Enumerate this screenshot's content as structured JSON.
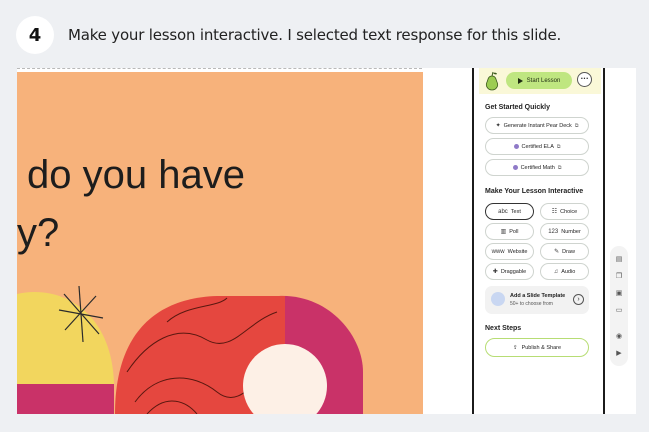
{
  "step": {
    "number": "4",
    "instruction": "Make your lesson interactive. I selected text response for this slide."
  },
  "slide": {
    "line1": "do you have",
    "line2": "y?"
  },
  "panel": {
    "start_label": "Start Lesson",
    "more_label": "···",
    "get_started_title": "Get Started Quickly",
    "get_started": [
      {
        "label": "Generate Instant Pear Deck",
        "icon": "sparkle-icon",
        "glyph": "✦",
        "external": "⧉"
      },
      {
        "label": "Certified ELA",
        "icon": "badge-icon",
        "glyph": "",
        "external": "⧉"
      },
      {
        "label": "Certified Math",
        "icon": "badge-icon",
        "glyph": "",
        "external": "⧉"
      }
    ],
    "interactive_title": "Make Your Lesson Interactive",
    "interactive": [
      {
        "label": "Text",
        "glyph": "abc",
        "icon": "text-response-icon",
        "selected": true
      },
      {
        "label": "Choice",
        "glyph": "☷",
        "icon": "choice-icon",
        "selected": false
      },
      {
        "label": "Poll",
        "glyph": "▥",
        "icon": "poll-icon",
        "selected": false
      },
      {
        "label": "Number",
        "glyph": "123",
        "icon": "number-icon",
        "selected": false
      },
      {
        "label": "Website",
        "glyph": "www",
        "icon": "website-icon",
        "selected": false
      },
      {
        "label": "Draw",
        "glyph": "✎",
        "icon": "draw-icon",
        "selected": false
      },
      {
        "label": "Draggable",
        "glyph": "✚",
        "icon": "draggable-icon",
        "selected": false
      },
      {
        "label": "Audio",
        "glyph": "♫",
        "icon": "audio-icon",
        "selected": false
      }
    ],
    "template_title": "Add a Slide Template",
    "template_sub": "50+ to choose from",
    "template_arrow": "›",
    "next_steps_title": "Next Steps",
    "publish_label": "Publish & Share",
    "publish_glyph": "⇪"
  },
  "rail": [
    {
      "icon": "slides-icon",
      "glyph": "▤"
    },
    {
      "icon": "layers-icon",
      "glyph": "❐"
    },
    {
      "icon": "notes-icon",
      "glyph": "▣"
    },
    {
      "icon": "folder-icon",
      "glyph": "▭"
    },
    {
      "icon": "record-icon",
      "glyph": "◉"
    },
    {
      "icon": "present-icon",
      "glyph": "▶"
    }
  ],
  "colors": {
    "slide_bg": "#f7b27b",
    "start_green": "#bfe680",
    "panel_header": "#faf8d8",
    "shape_red": "#e5473f",
    "shape_magenta": "#c93268",
    "shape_yellow": "#f2d65e"
  }
}
